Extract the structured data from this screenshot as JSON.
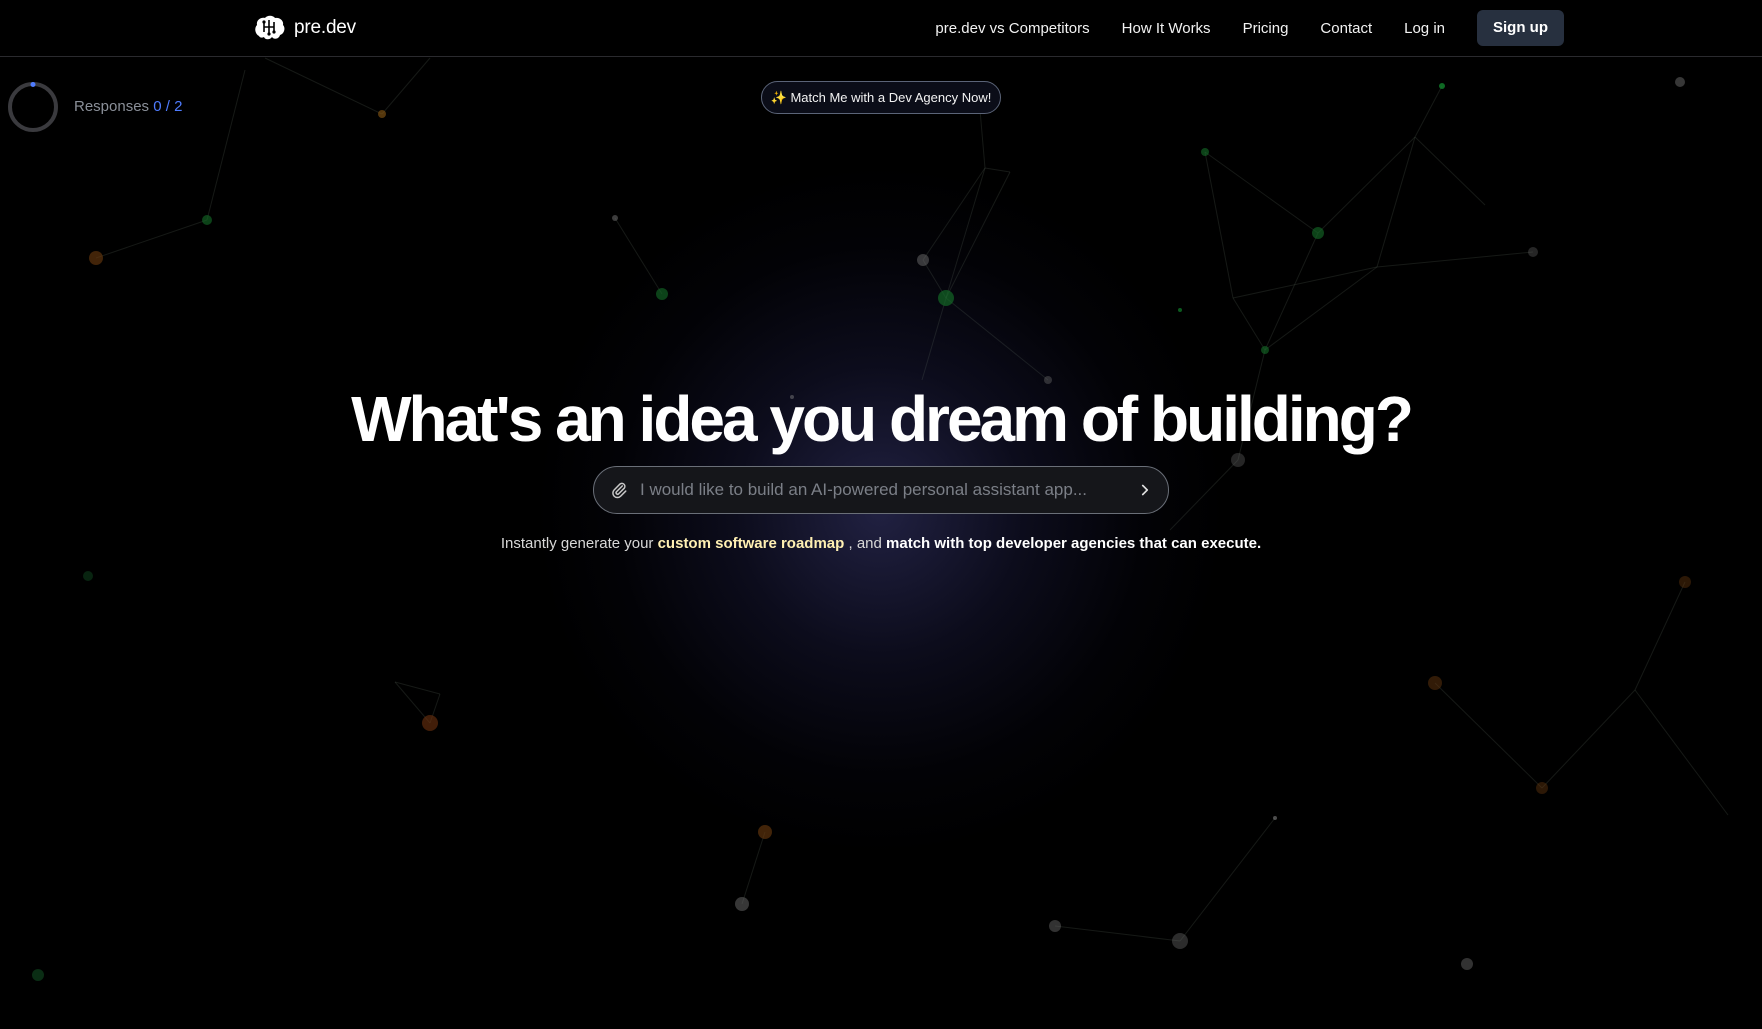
{
  "brand": {
    "name": "pre.dev"
  },
  "nav": {
    "links": [
      "pre.dev vs Competitors",
      "How It Works",
      "Pricing",
      "Contact",
      "Log in"
    ],
    "signup_label": "Sign up"
  },
  "progress": {
    "label": "Responses",
    "count": "0 / 2",
    "fraction": 0.0
  },
  "match_button": {
    "icon": "sparkles-icon",
    "label": "✨ Match Me with a Dev Agency Now!"
  },
  "hero": {
    "headline": "What's an idea you dream of building?"
  },
  "search": {
    "placeholder": "I would like to build an AI-powered personal assistant app...",
    "value": ""
  },
  "tagline": {
    "prefix": "Instantly generate your",
    "highlight": "custom software roadmap",
    "middle": ", and",
    "bold": "match with top developer agencies that can execute."
  },
  "colors": {
    "background": "#000000",
    "accent": "#4f7cff",
    "highlight": "#fff0b3",
    "signup_bg": "#27303f"
  }
}
